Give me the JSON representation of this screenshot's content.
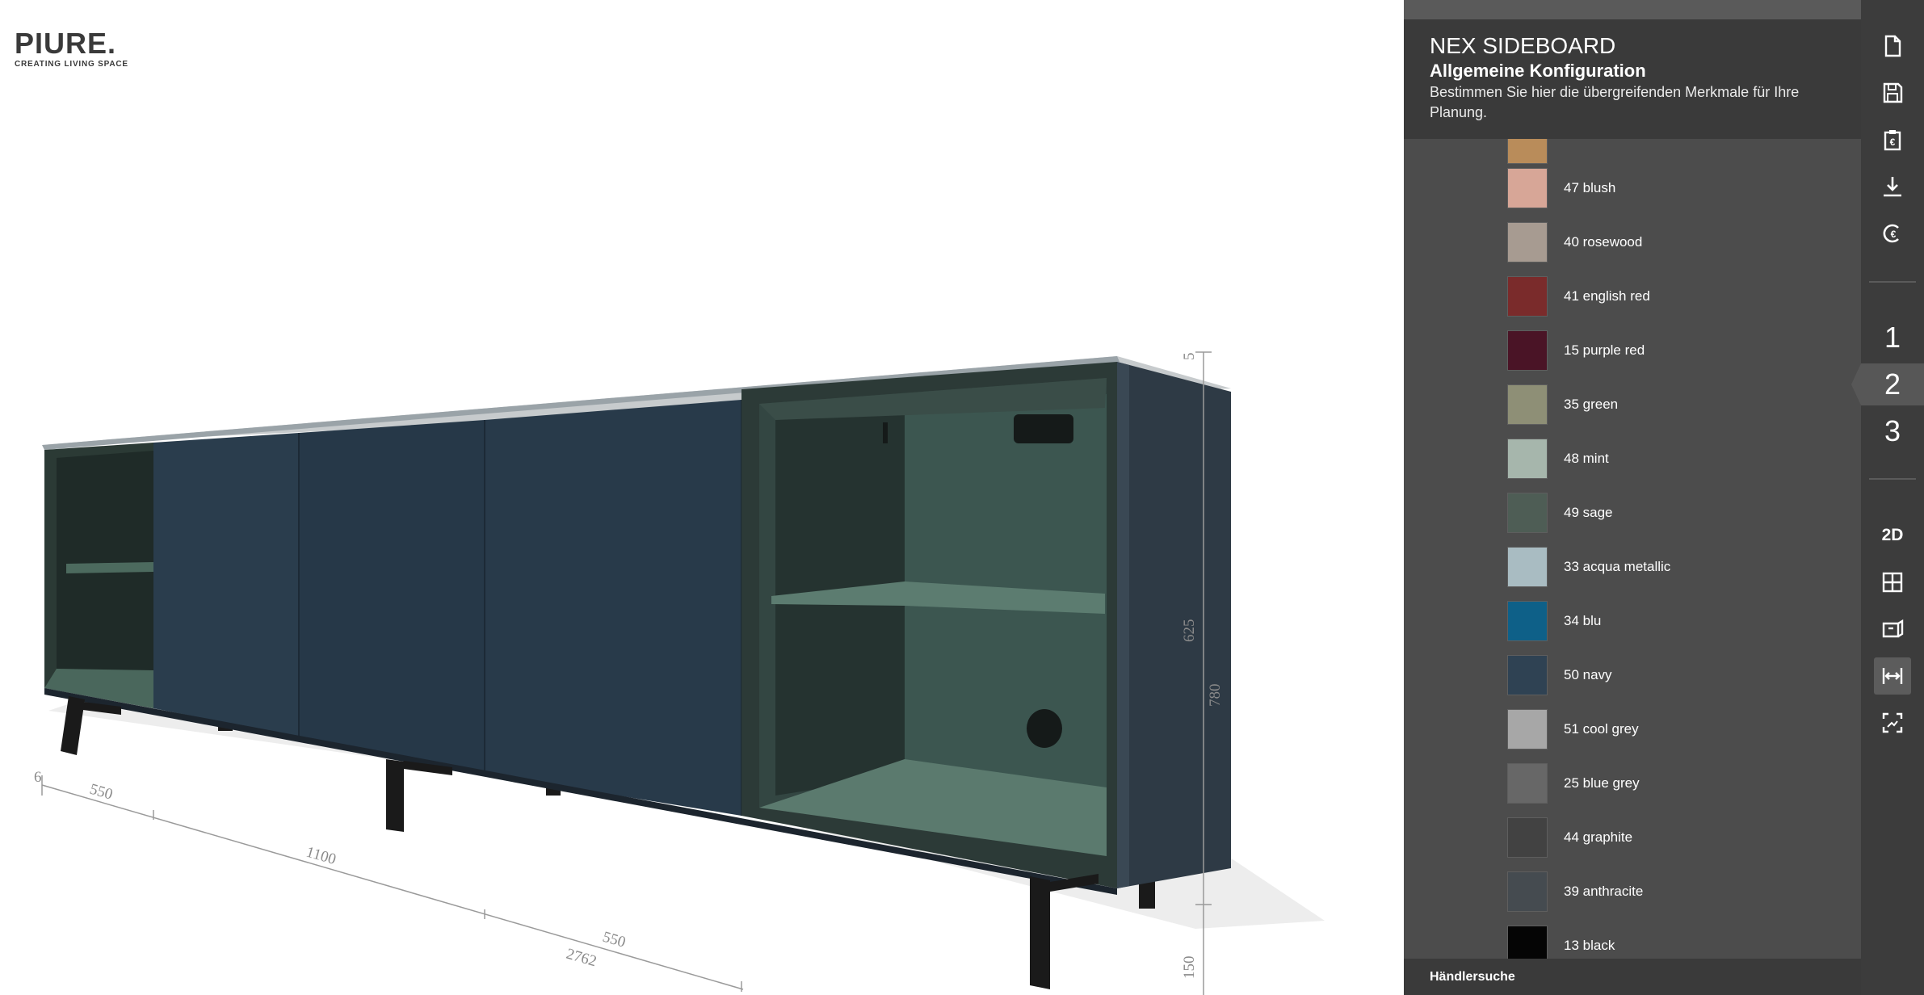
{
  "logo": {
    "brand": "PIURE.",
    "tagline": "CREATING LIVING SPACE"
  },
  "dimensions": {
    "small": "6",
    "left_module": "550",
    "middle_module": "1100",
    "right_module": "550",
    "total_width": "2762",
    "top_thickness": "5",
    "body_height": "625",
    "total_height": "780",
    "leg_height": "150"
  },
  "panel": {
    "title": "NEX SIDEBOARD",
    "subtitle": "Allgemeine Konfiguration",
    "description": "Bestimmen Sie hier die übergreifenden Merkmale für Ihre Planung.",
    "footer_label": "Händlersuche",
    "colors": [
      {
        "label": "",
        "hex": "#b98c5a"
      },
      {
        "label": "47 blush",
        "hex": "#d7a697"
      },
      {
        "label": "40 rosewood",
        "hex": "#a79b91"
      },
      {
        "label": "41 english red",
        "hex": "#7a2b2b"
      },
      {
        "label": "15 purple red",
        "hex": "#4a1426"
      },
      {
        "label": "35 green",
        "hex": "#8e8f76"
      },
      {
        "label": "48 mint",
        "hex": "#a6b6ac"
      },
      {
        "label": "49 sage",
        "hex": "#4e5d55"
      },
      {
        "label": "33 acqua metallic",
        "hex": "#a9bcc2"
      },
      {
        "label": "34 blu",
        "hex": "#0e6088"
      },
      {
        "label": "50 navy",
        "hex": "#2f4253"
      },
      {
        "label": "51 cool grey",
        "hex": "#a7a7a7"
      },
      {
        "label": "25 blue grey",
        "hex": "#676767"
      },
      {
        "label": "44 graphite",
        "hex": "#424242"
      },
      {
        "label": "39 anthracite",
        "hex": "#454b50"
      },
      {
        "label": "13 black",
        "hex": "#050505"
      }
    ]
  },
  "toolbar": {
    "icons": [
      "new-file-icon",
      "save-icon",
      "price-list-icon",
      "download-icon",
      "currency-icon"
    ],
    "steps": [
      "1",
      "2",
      "3"
    ],
    "active_step": "2",
    "view_2d_label": "2D",
    "view_icons": [
      "grid-view-icon",
      "room-view-icon",
      "measure-icon",
      "fullscreen-icon"
    ]
  },
  "colors": {
    "panel_bg": "#4c4c4c",
    "panel_header_bg": "#3a3a3a",
    "toolbar_bg": "#3c3c3c",
    "sideboard_front": "#273847",
    "sideboard_interior": "#3f5a50"
  }
}
